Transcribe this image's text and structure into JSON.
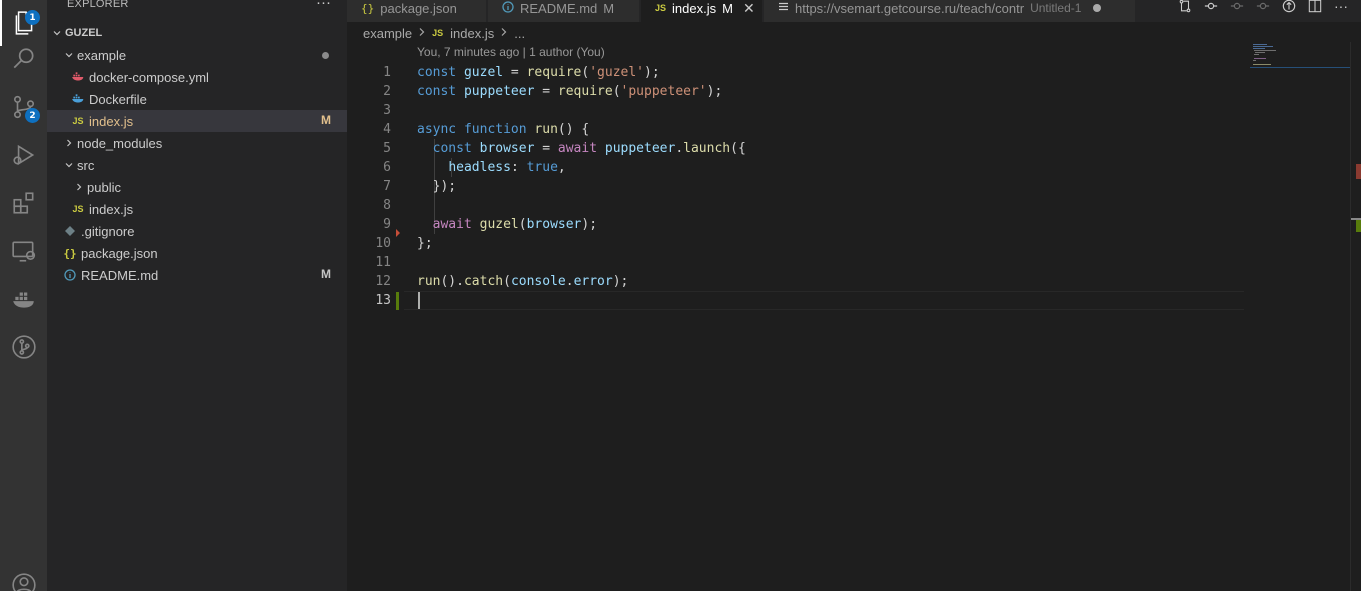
{
  "activity_bar": {
    "explorer_badge": "1",
    "scm_badge": "2"
  },
  "sidebar": {
    "title": "EXPLORER",
    "more": "···",
    "root": "GUZEL",
    "items": [
      {
        "label": "example",
        "kind": "folder-open",
        "deco": ""
      },
      {
        "label": "docker-compose.yml",
        "kind": "file",
        "deco": ""
      },
      {
        "label": "Dockerfile",
        "kind": "file",
        "deco": ""
      },
      {
        "label": "index.js",
        "kind": "file",
        "deco": "M"
      },
      {
        "label": "node_modules",
        "kind": "folder",
        "deco": ""
      },
      {
        "label": "src",
        "kind": "folder-open",
        "deco": ""
      },
      {
        "label": "public",
        "kind": "folder",
        "deco": ""
      },
      {
        "label": "index.js",
        "kind": "file",
        "deco": ""
      },
      {
        "label": ".gitignore",
        "kind": "file",
        "deco": ""
      },
      {
        "label": "package.json",
        "kind": "file",
        "deco": ""
      },
      {
        "label": "README.md",
        "kind": "file",
        "deco": "M"
      }
    ]
  },
  "tabs": [
    {
      "label": "package.json",
      "icon": "{}"
    },
    {
      "label": "README.md",
      "icon": "info-icon",
      "status": "M"
    },
    {
      "label": "index.js",
      "icon": "JS",
      "status": "M"
    },
    {
      "label": "https://vsemart.getcourse.ru/teach/contr",
      "desc": "Untitled-1",
      "icon": "menu-icon"
    }
  ],
  "breadcrumb": {
    "folder": "example",
    "file": "index.js",
    "rest": "..."
  },
  "editor": {
    "blame": "You, 7 minutes ago | 1 author (You)",
    "line_numbers": [
      "1",
      "2",
      "3",
      "4",
      "5",
      "6",
      "7",
      "8",
      "9",
      "10",
      "11",
      "12",
      "13"
    ]
  },
  "colors": {
    "accent": "#0e70c0",
    "modified_gutter": "#587c0c",
    "deleted_gutter": "#c74e39"
  }
}
